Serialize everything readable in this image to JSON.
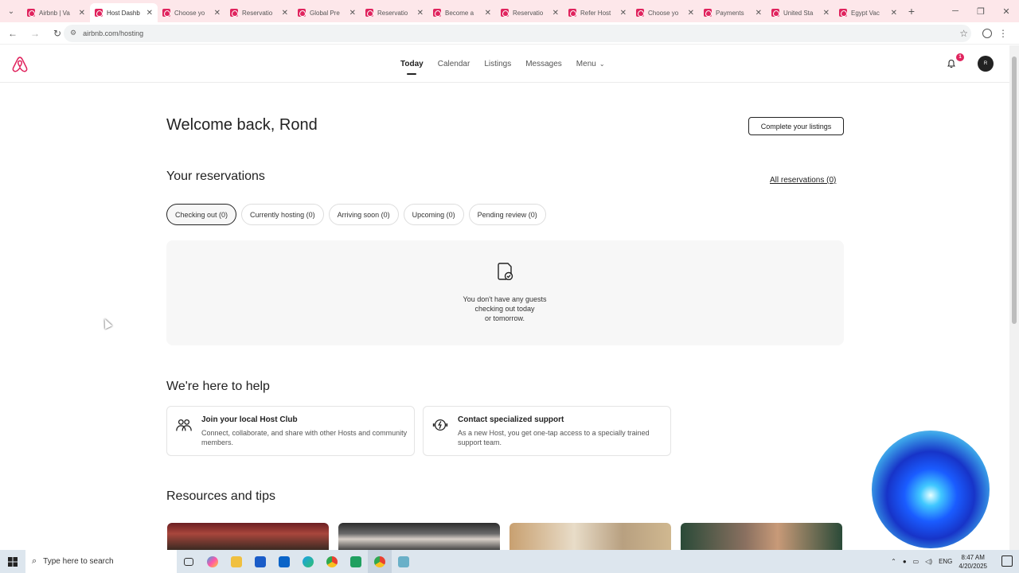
{
  "browser": {
    "tabs": [
      {
        "title": "Airbnb | Va",
        "active": false
      },
      {
        "title": "Host Dashb",
        "active": true
      },
      {
        "title": "Choose yo",
        "active": false
      },
      {
        "title": "Reservatio",
        "active": false
      },
      {
        "title": "Global Pre",
        "active": false
      },
      {
        "title": "Reservatio",
        "active": false
      },
      {
        "title": "Become a",
        "active": false
      },
      {
        "title": "Reservatio",
        "active": false
      },
      {
        "title": "Refer Host",
        "active": false
      },
      {
        "title": "Choose yo",
        "active": false
      },
      {
        "title": "Payments",
        "active": false
      },
      {
        "title": "United Sta",
        "active": false
      },
      {
        "title": "Egypt Vac",
        "active": false
      }
    ],
    "url": "airbnb.com/hosting"
  },
  "header": {
    "nav": [
      {
        "label": "Today",
        "active": true
      },
      {
        "label": "Calendar",
        "active": false
      },
      {
        "label": "Listings",
        "active": false
      },
      {
        "label": "Messages",
        "active": false
      },
      {
        "label": "Menu",
        "active": false
      }
    ],
    "notification_count": "1",
    "avatar_initial": "R"
  },
  "main": {
    "welcome": "Welcome back, Rond",
    "complete_listings": "Complete your listings",
    "reservations_title": "Your reservations",
    "all_reservations": "All reservations (0)",
    "filters": [
      {
        "label": "Checking out (0)",
        "active": true
      },
      {
        "label": "Currently hosting (0)",
        "active": false
      },
      {
        "label": "Arriving soon (0)",
        "active": false
      },
      {
        "label": "Upcoming (0)",
        "active": false
      },
      {
        "label": "Pending review (0)",
        "active": false
      }
    ],
    "empty_line1": "You don't have any guests",
    "empty_line2": "checking out today",
    "empty_line3": "or tomorrow.",
    "help_title": "We're here to help",
    "help_cards": [
      {
        "title": "Join your local Host Club",
        "desc": "Connect, collaborate, and share with other Hosts and community members."
      },
      {
        "title": "Contact specialized support",
        "desc": "As a new Host, you get one-tap access to a specially trained support team."
      }
    ],
    "resources_title": "Resources and tips"
  },
  "taskbar": {
    "search_placeholder": "Type here to search",
    "lang": "ENG",
    "time": "8:47 AM",
    "date": "4/20/2025"
  },
  "colors": {
    "brand": "#e0245e",
    "text": "#222222"
  }
}
